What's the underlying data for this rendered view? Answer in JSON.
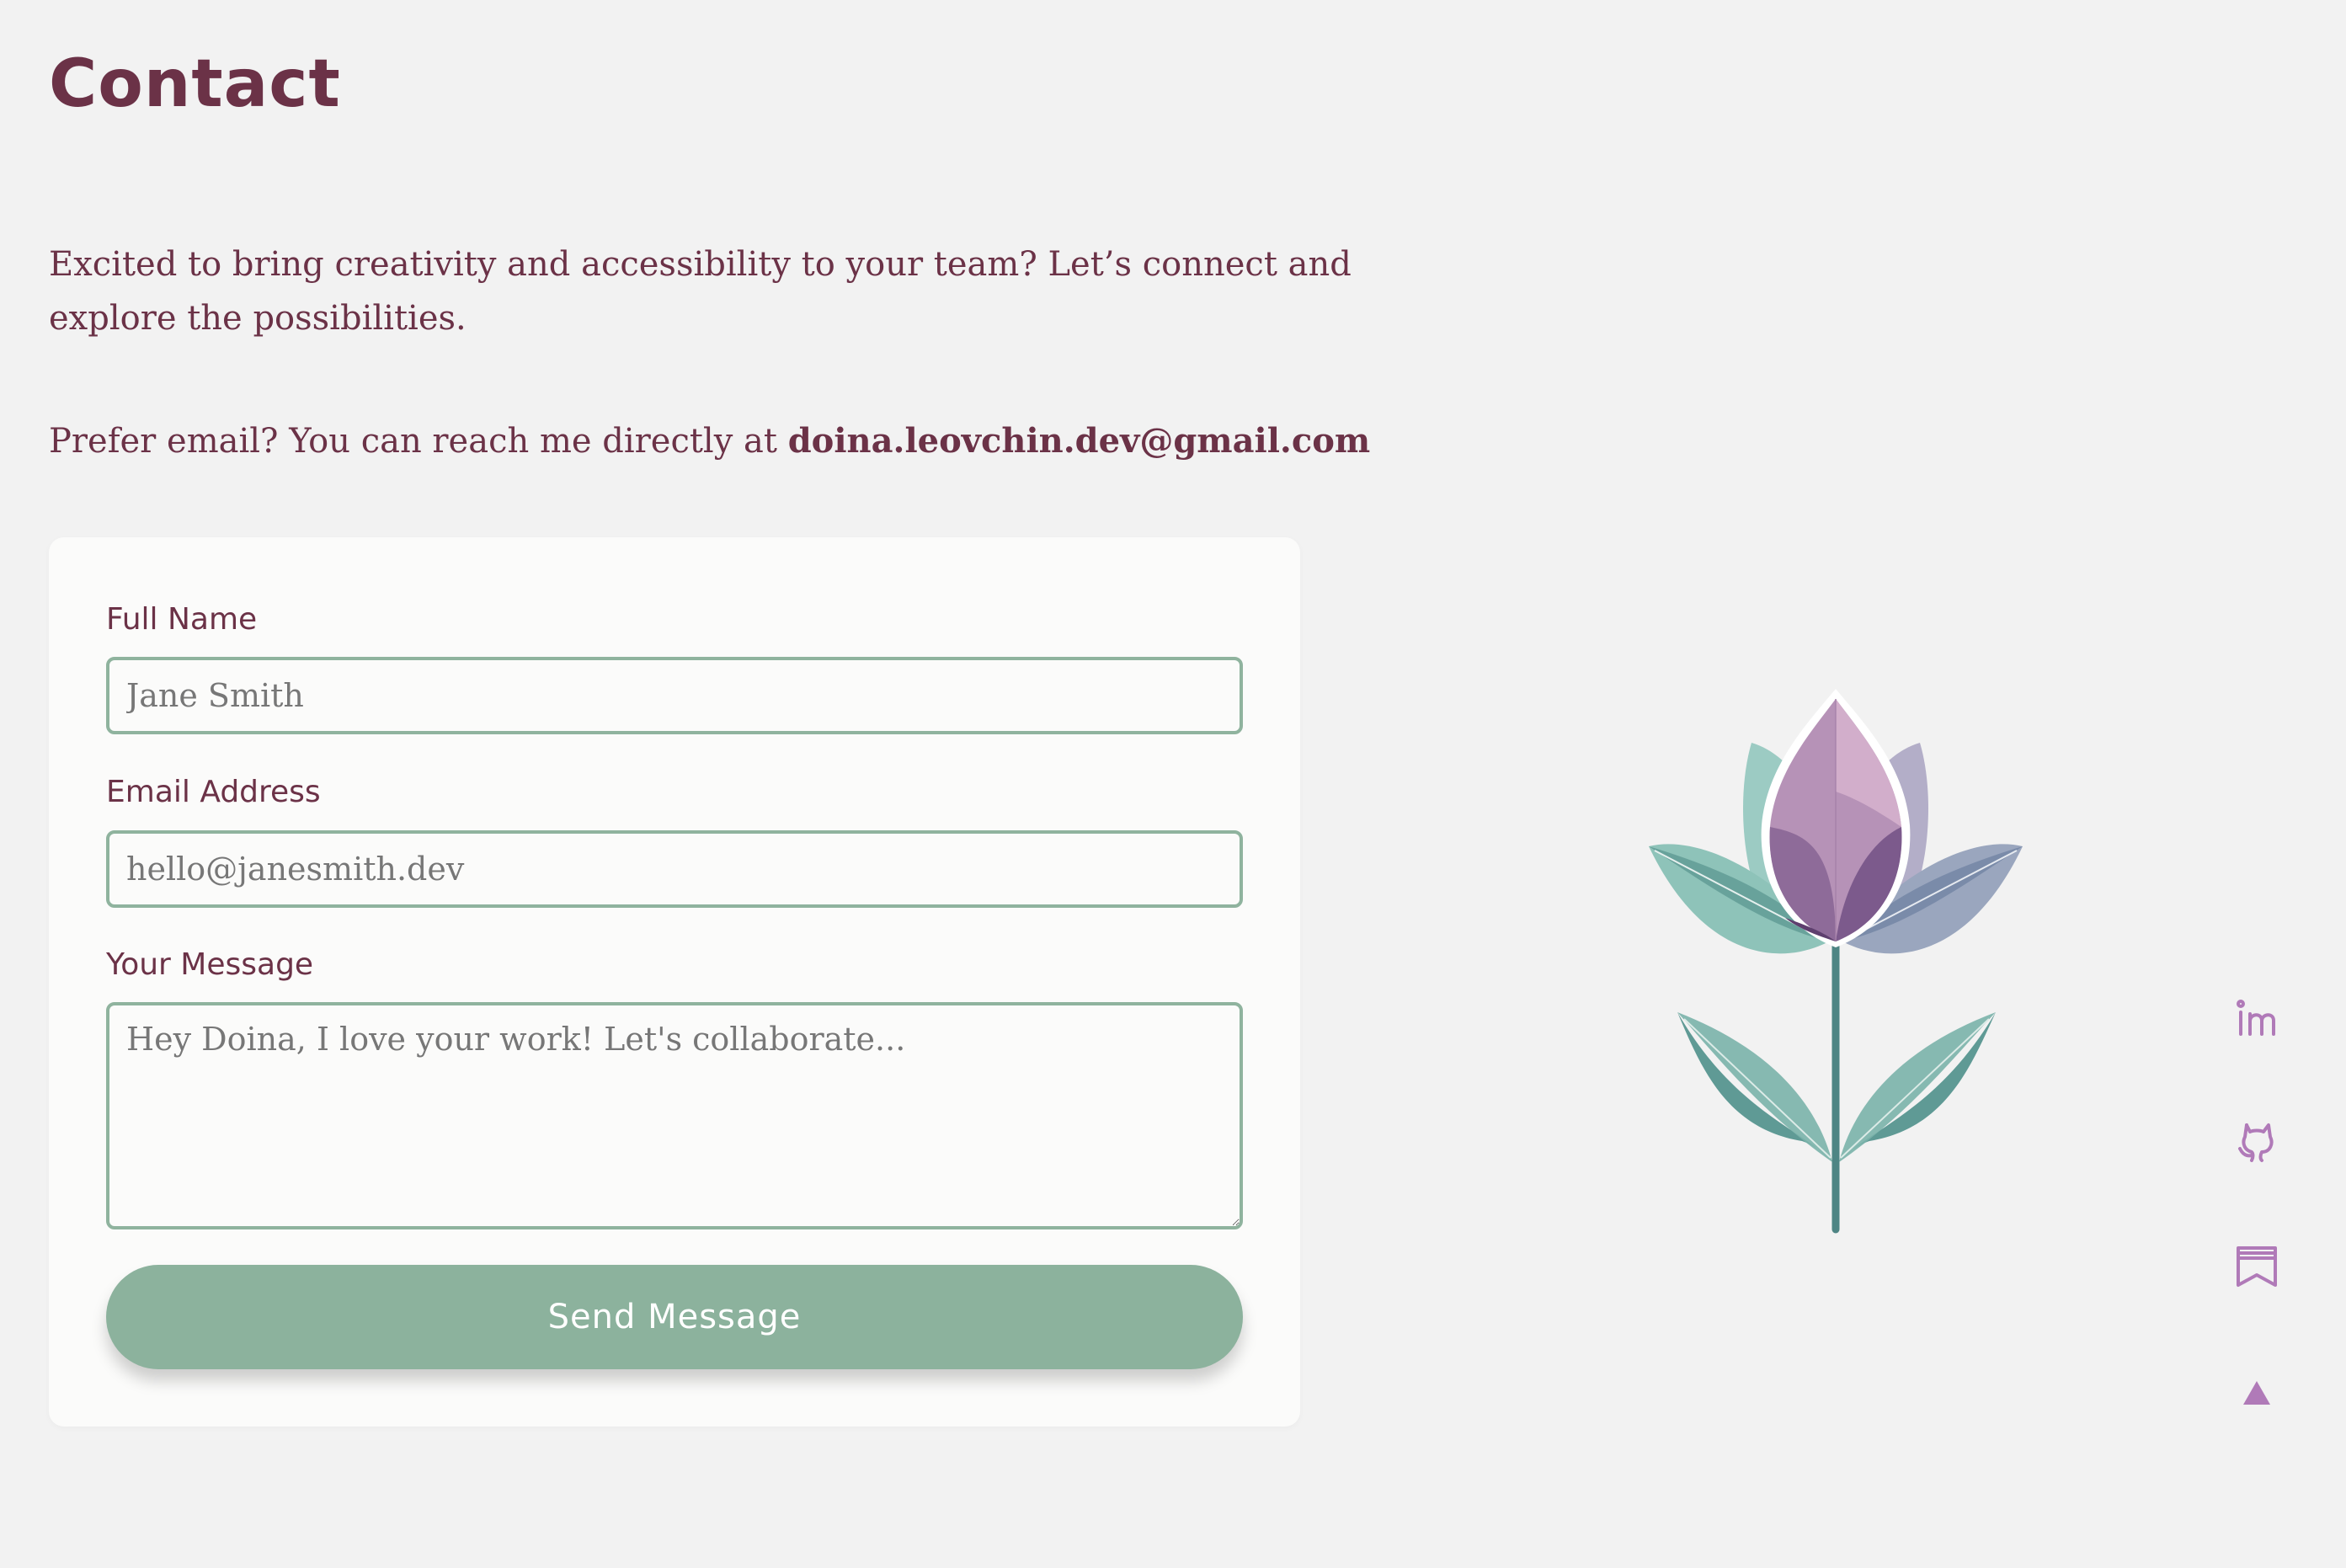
{
  "page": {
    "title": "Contact",
    "intro": "Excited to bring creativity and accessibility to your team? Let’s connect and explore the possibilities.",
    "email_prefix": "Prefer email? You can reach me directly at ",
    "email": "doina.leovchin.dev@gmail.com"
  },
  "form": {
    "name_label": "Full Name",
    "name_placeholder": "Jane Smith",
    "email_label": "Email Address",
    "email_placeholder": "hello@janesmith.dev",
    "message_label": "Your Message",
    "message_placeholder": "Hey Doina, I love your work! Let's collaborate...",
    "submit_label": "Send Message"
  },
  "social": [
    {
      "icon": "linkedin-icon"
    },
    {
      "icon": "github-icon"
    },
    {
      "icon": "blog-icon"
    },
    {
      "icon": "scroll-to-top-icon"
    }
  ],
  "colors": {
    "background": "#f2f2f2",
    "text": "#6b3247",
    "accent_green": "#8cb29d",
    "icon_purple": "#b07ab8",
    "card": "#fbfbfa"
  }
}
